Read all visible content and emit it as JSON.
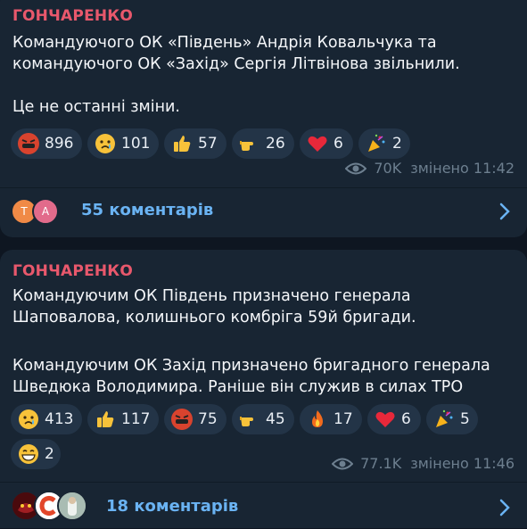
{
  "posts": [
    {
      "author": "ГОНЧАРЕНКО",
      "lines": [
        "Командуючого ОК «Південь» Андрія Ковальчука та",
        "командуючого ОК «Захід» Сергія Літвінова звільнили.",
        "",
        "Це не останні зміни."
      ],
      "reactions": [
        {
          "icon": "angry-face-icon",
          "count": "896"
        },
        {
          "icon": "crying-face-icon",
          "count": "101"
        },
        {
          "icon": "thumbs-up-icon",
          "count": "57"
        },
        {
          "icon": "pointing-hand-icon",
          "count": "26"
        },
        {
          "icon": "heart-icon",
          "count": "6"
        },
        {
          "icon": "party-popper-icon",
          "count": "2"
        }
      ],
      "views": "70K",
      "edited": "змінено 11:42",
      "comments": {
        "avatars": [
          "Т",
          "А"
        ],
        "label": "55 коментарів"
      }
    },
    {
      "author": "ГОНЧАРЕНКО",
      "lines": [
        "Командуючим ОК Південь призначено генерала",
        "Шаповалова, колишнього комбріга 59й бригади.",
        "",
        "Командуючим ОК Захід призначено бригадного генерала",
        "Шведюка Володимира. Раніше він служив в силах ТРО"
      ],
      "reactions": [
        {
          "icon": "crying-face-icon",
          "count": "413"
        },
        {
          "icon": "thumbs-up-icon",
          "count": "117"
        },
        {
          "icon": "angry-face-icon",
          "count": "75"
        },
        {
          "icon": "pointing-hand-icon",
          "count": "45"
        },
        {
          "icon": "fire-icon",
          "count": "17"
        },
        {
          "icon": "heart-icon",
          "count": "6"
        },
        {
          "icon": "party-popper-icon",
          "count": "5"
        },
        {
          "icon": "grinning-face-icon",
          "count": "2"
        }
      ],
      "views": "77.1K",
      "edited": "змінено 11:46",
      "comments": {
        "label": "18 коментарів"
      }
    }
  ],
  "colors": {
    "background": "#0e1621",
    "bubble": "#182533",
    "author": "#e8586c",
    "link": "#6ab3f3",
    "meta": "#6d7f8f",
    "pill": "#233447"
  }
}
